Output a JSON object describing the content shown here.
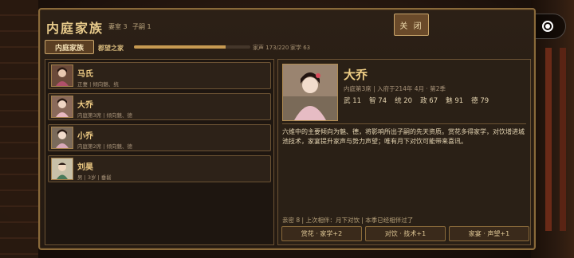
{
  "header": {
    "title": "内庭家族",
    "wives_label": "妻室 3",
    "children_label": "子嗣 1",
    "close_label": "关 闭"
  },
  "tab": {
    "label": "内庭家族",
    "subtitle": "郡望之家"
  },
  "prestige": {
    "text": "家声 173/220",
    "value": 173,
    "max": 220,
    "study_text": "家学 63"
  },
  "members": [
    {
      "name": "马氏",
      "desc": "正妻 | 倾向魅、统"
    },
    {
      "name": "大乔",
      "desc": "内庭第3席 | 倾向魅、德"
    },
    {
      "name": "小乔",
      "desc": "内庭第2席 | 倾向魅、德"
    },
    {
      "name": "刘昊",
      "desc": "男 | 3岁 | 垂髫"
    }
  ],
  "detail": {
    "name": "大乔",
    "sub": "内庭第3席 | 入府于214年 4月 · 第2季",
    "stats": [
      "武 11",
      "智 74",
      "统 20",
      "政 67",
      "魅 91",
      "德 79"
    ],
    "description": "六维中的主要倾向为魅、德，将影响所出子嗣的先天资质。赏花多得家学，对饮增进城池技术，家宴提升家声与势力声望；唯有月下对饮可能带来喜讯。",
    "footer": "亲密 8 | 上次相伴：月下对饮 | 本季已经相伴过了",
    "actions": [
      "赏花 · 家学+2",
      "对饮 · 技术+1",
      "家宴 · 声望+1"
    ]
  },
  "colors": {
    "accent": "#c79a52",
    "border": "#8a6a3a",
    "text": "#d8c6a3"
  }
}
